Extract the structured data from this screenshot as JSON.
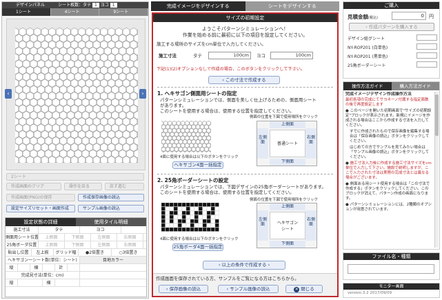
{
  "left": {
    "title": "デザインパネル",
    "counter": "シート枚数：タテ",
    "counter_val": "1",
    "counter_sep": "ヨコ",
    "counter_val2": "1",
    "tabs": [
      "1シート",
      "4シート",
      "9シート"
    ],
    "sheet_label": "2シート",
    "btn_clear": "作成画面のクリア",
    "btn_back": "操作を戻る",
    "btn_fwd": "戻す進む",
    "btn_save_pc": "作成画面(PNG)の保存",
    "btn_load_save": "作成保存画像の読込",
    "btn_size_reset": "設定サイズリセット・画面作成",
    "btn_sample": "サンプル画像の読込",
    "status_title": "設定状態の詳細",
    "tile_title": "使用タイル明細",
    "size_label": "施工寸法",
    "tate": "タテ",
    "yoko": "ヨコ",
    "row1": "側面用シート位置",
    "row2": "25角ボーダ位置",
    "pos_labels": [
      "上側面",
      "下側面",
      "左側面",
      "右側面"
    ],
    "paste_label": "貼出し位置",
    "paste_val": "左上揃",
    "grid_label": "グリッド幅",
    "grid_opt1": "2倍置き",
    "grid_opt2": "3倍置き",
    "sheet_count_label": "ヘキサゴン一シート数(単位：シート)",
    "tate2": "縦",
    "yoko2": "横",
    "total": "計",
    "finished_label": "完成見寸法(単位：cm)",
    "eyecolor_title": "目地カラー"
  },
  "mid": {
    "tab_on": "完成イメージをデザインする",
    "tab_off": "シートをデザインする",
    "dialog_title": "サイズの初期設定",
    "welcome1": "ようこそパターンシミュレーションへ！",
    "welcome2": "作業を始める前に最初に以下の項目を設定してください。",
    "instr": "施工する場所のサイズをcm単位で入力してください。",
    "size_label": "施工寸法",
    "tate": "タテ",
    "tate_val": "100",
    "unit": "cm",
    "yoko": "ヨコ",
    "yoko_val": "100",
    "note_red": "下記(1)(2)オプションなしで作成の場合、このボタンをクリックして下さい。",
    "btn_create_size": "この寸法で作成する",
    "sec1_title": "1. ヘキサゴン側面用シートの指定",
    "sec1_l1": "パターンシミュレーションでは、側面を美しく仕上げるための、側面用シート",
    "sec1_l2": "があります。",
    "sec1_l3": "このシートを使用する場合は、使用する位置を指定してください。",
    "click_hint": "側面の位置を下図で使用場所をクリック",
    "sample_caption": "4面に使用する場合は以下のボタンをクリック",
    "btn_hex_all": "ヘキサゴン4面一括指定",
    "diag_top": "上側面",
    "diag_bottom": "下側面",
    "diag_left": "左側面",
    "diag_right": "右側面",
    "diag_center1": "普通シート",
    "sec2_title": "2. 25角ボーダーシートの設定",
    "sec2_l1": "パターンシミュレーションでは、下図デザインの25角ボーダーシートがあります。",
    "sec2_l2": "このシートを使用する場合は、使用する位置を指定してください。",
    "click_hint2": "側面の位置を下図で使用場所をクリック",
    "sample_caption2": "4面に使用する場合は以下のボタンをクリック",
    "btn_border_all": "25角ボーダ4面一括指定",
    "diag_center2a": "ヘキサゴン",
    "diag_center2b": "シート",
    "btn_create_cond": "以上の条件で作成する",
    "footer_note": "作成画面を保存されている方、サンプルをご覧になる方はこちらから。",
    "btn_load_saved": "保存画像の読込",
    "btn_load_sample": "サンプル画像の読込",
    "btn_close": "閉じる"
  },
  "right": {
    "buy_title": "ご購入",
    "estimate_label": "見積金額",
    "estimate_note": "(税込)",
    "estimate_val": "0",
    "yen": "円",
    "btn_buy": "作成パターンを購入する",
    "design_total": "デザイン総グシート",
    "item1": "NY-ROP201 (白単色)",
    "item2": "NY-ROP201 (黒単色)",
    "item3": "25角ボーダーシート",
    "guide_tab1": "操作方法ガイド",
    "guide_tab2": "購入方法ガイド",
    "guide_title": "完成イメージデザイン作成操作方法",
    "guide_red1": "最初各項の完成にてサヨネーノ付属する指定面数の後で再度設定します",
    "guide_b1": "このページを開いた初期画面で\"サイズの初期設定\"ブロックが表示されます。新規にイメージを作成される場合はここから作成する寸法を入力してください。",
    "guide_b1b": "すでに作成されたもので保存画像を編集する場合は「保存画像の読込」ボタンをクリックしてください。",
    "guide_b1c": "はじめての方でサンプルを見てみたい場合は「サンプル画像の読込」ボタンをクリックしてください。",
    "guide_b2_red": "施工寸法入力後に作成する施工寸法サイズをcm単位で入力して下さい。",
    "guide_b2": "施設で説明しますが、ここで入力された寸法は実際の完成寸法とは異なる場合がございます。",
    "guide_b3": "側面ある用シート使用する場合は「この寸法で作成する」ボタンをクリックしてください。",
    "guide_b3b": "このブロックが消えて、パターン作成の画面になります。",
    "guide_b4": "パターンシミュレーションには、2種類のオプションが用意されています。",
    "file_title": "ファイル名・種類",
    "monitor_title": "モニター画面",
    "version": "version.3.2 2017/09/09"
  },
  "colors": {
    "accent_red": "#c0282d",
    "dark_header": "#2b2b2b",
    "button_blue": "#23416e"
  }
}
